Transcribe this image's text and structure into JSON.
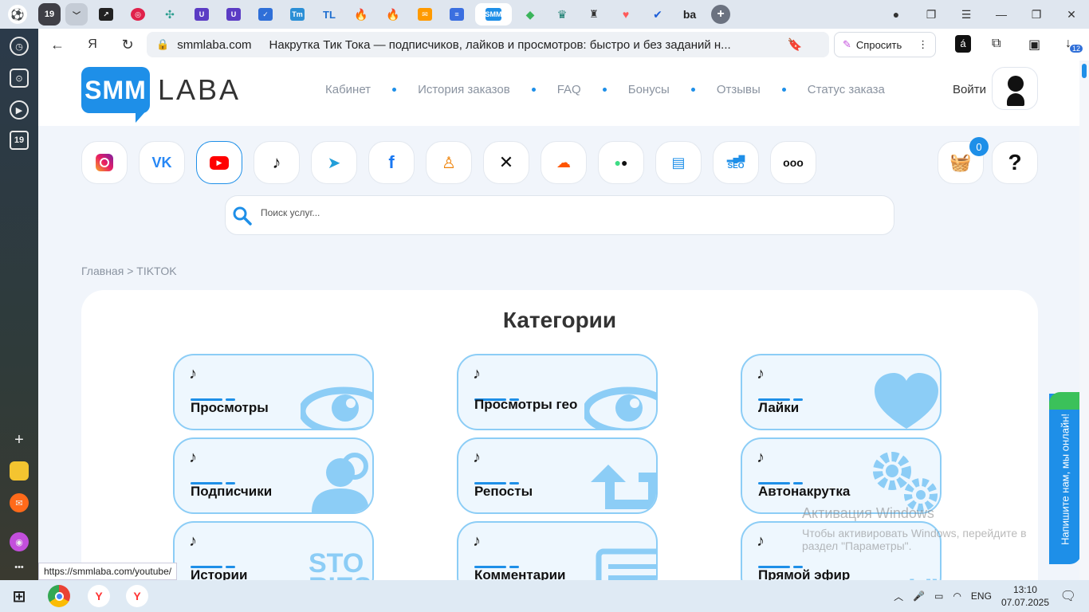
{
  "browser": {
    "tab_counter": "19",
    "url_domain": "smmlaba.com",
    "page_title": "Накрутка Тик Тока — подписчиков, лайков и просмотров: быстро и без заданий н...",
    "ask_label": "Спросить",
    "downloads_badge": "12",
    "ya_button": "Я",
    "status_url": "https://smmlaba.com/youtube/"
  },
  "site": {
    "logo_smm": "SMM",
    "logo_laba": "LABA",
    "nav": [
      "Кабинет",
      "История заказов",
      "FAQ",
      "Бонусы",
      "Отзывы",
      "Статус заказа"
    ],
    "login": "Войти",
    "cart_count": "0",
    "search_placeholder": "Поиск услуг...",
    "breadcrumb_home": "Главная",
    "breadcrumb_sep": ">",
    "breadcrumb_current": "TIKTOK",
    "categories_title": "Категории",
    "categories": [
      {
        "label": "Просмотры"
      },
      {
        "label": "Просмотры гео"
      },
      {
        "label": "Лайки"
      },
      {
        "label": "Подписчики"
      },
      {
        "label": "Репосты"
      },
      {
        "label": "Автонакрутка"
      },
      {
        "label": "Истории",
        "art_text": "STORIES"
      },
      {
        "label": "Комментарии"
      },
      {
        "label": "Прямой эфир",
        "art_text": "LIVE"
      }
    ],
    "networks": [
      "instagram",
      "vk",
      "youtube",
      "tiktok",
      "telegram",
      "facebook",
      "odnoklassniki",
      "x",
      "soundcloud",
      "apps",
      "chat",
      "seo",
      "more"
    ],
    "networks_text": {
      "vk": "VK",
      "seo_caption": "SEO"
    },
    "help_symbol": "?",
    "chat_label": "Напишите нам, мы онлайн!"
  },
  "windows": {
    "watermark_title": "Активация Windows",
    "watermark_line1": "Чтобы активировать Windows, перейдите в",
    "watermark_line2": "раздел \"Параметры\".",
    "language": "ENG",
    "time": "13:10",
    "date": "07.07.2025"
  },
  "colors": {
    "accent": "#1e8fe8",
    "card_border": "#8ccdf6",
    "card_bg": "#eef7fe",
    "art": "#8ccdf6"
  }
}
